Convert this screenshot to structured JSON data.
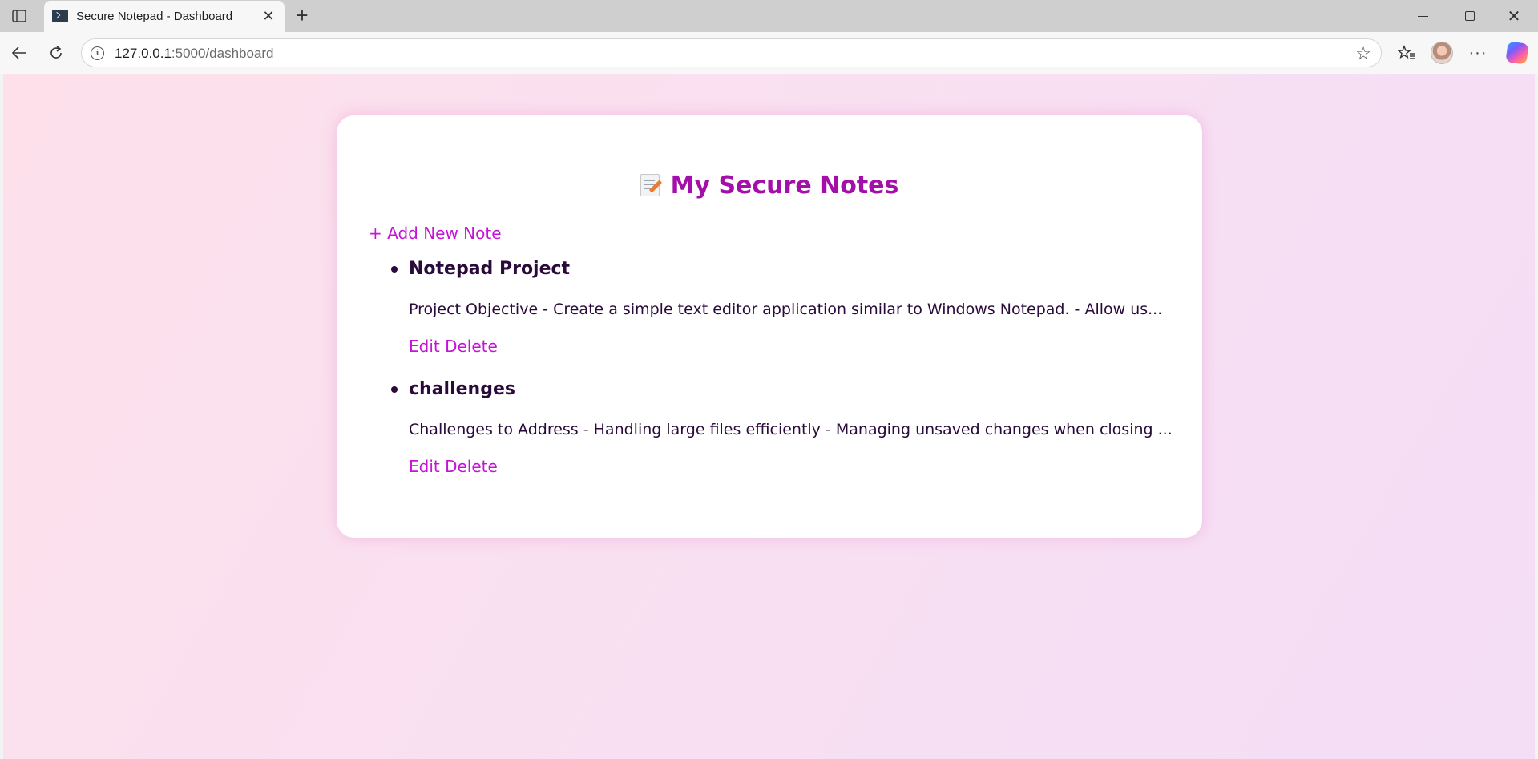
{
  "browser": {
    "tab_title": "Secure Notepad - Dashboard",
    "url_host": "127.0.0.1",
    "url_path": ":5000/dashboard",
    "new_tab_glyph": "+",
    "close_glyph": "✕",
    "more_glyph": "···"
  },
  "page": {
    "heading": "My Secure Notes",
    "heading_icon": "memo-icon",
    "add_link": "+ Add New Note",
    "notes": [
      {
        "title": "Notepad Project",
        "preview": "Project Objective - Create a simple text editor application similar to Windows Notepad. - Allow us...",
        "edit_label": "Edit",
        "delete_label": "Delete"
      },
      {
        "title": "challenges",
        "preview": "Challenges to Address - Handling large files efficiently - Managing unsaved changes when closing ...",
        "edit_label": "Edit",
        "delete_label": "Delete"
      }
    ]
  },
  "colors": {
    "heading": "#a30fa8",
    "link": "#c414d6",
    "text": "#2a0a3a",
    "background_start": "#fde0ea",
    "background_end": "#f4def6"
  }
}
